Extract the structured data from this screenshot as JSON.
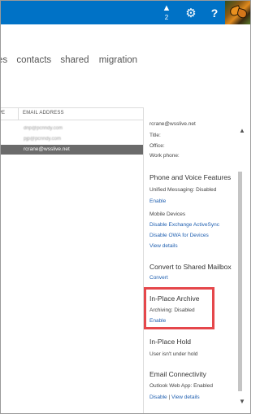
{
  "topbar": {
    "alert_count": "2",
    "bg_color": "#0072c6",
    "icons": [
      "alert-icon",
      "gear-icon",
      "help-icon",
      "user-photo"
    ]
  },
  "nav": {
    "items": [
      "es",
      "contacts",
      "shared",
      "migration"
    ]
  },
  "list": {
    "columns": [
      "PE",
      "EMAIL ADDRESS"
    ],
    "rows": [
      "dnp@pcrindy.com",
      "pjp@pcrindy.com",
      "rcrane@wsslive.net"
    ],
    "selected_index": 2
  },
  "details": {
    "email": "rcrane@wsslive.net",
    "title_label": "Title:",
    "office_label": "Office:",
    "work_phone_label": "Work phone:",
    "phone_voice": {
      "heading": "Phone and Voice Features",
      "unified_messaging": "Unified Messaging:  Disabled",
      "enable": "Enable",
      "mobile_devices": "Mobile Devices",
      "disable_activesync": "Disable Exchange ActiveSync",
      "disable_owa": "Disable OWA for Devices",
      "view_details": "View details"
    },
    "convert": {
      "heading": "Convert to Shared Mailbox",
      "link": "Convert"
    },
    "archive": {
      "heading": "In-Place Archive",
      "status": "Archiving:  Disabled",
      "enable": "Enable"
    },
    "hold": {
      "heading": "In-Place Hold",
      "status": "User isn't under hold"
    },
    "email_connectivity": {
      "heading": "Email Connectivity",
      "owa": "Outlook Web App:  Enabled",
      "disable": "Disable",
      "separator": "|",
      "view_details": "View details"
    }
  },
  "highlight_color": "#e5474b"
}
